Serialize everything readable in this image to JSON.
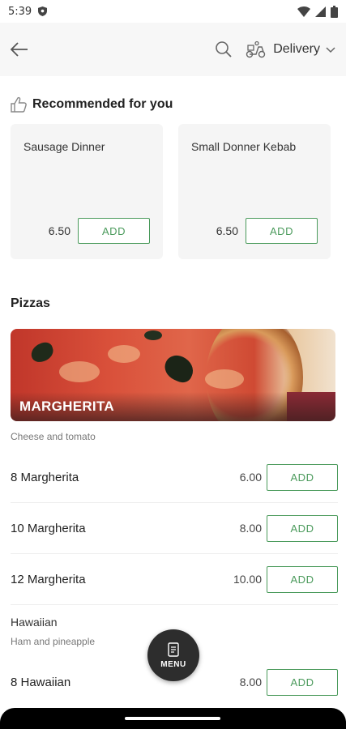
{
  "status_bar": {
    "time": "5:39"
  },
  "app_bar": {
    "delivery_label": "Delivery"
  },
  "recommended": {
    "title": "Recommended for you",
    "items": [
      {
        "name": "Sausage Dinner",
        "price": "6.50",
        "add_label": "ADD"
      },
      {
        "name": "Small Donner Kebab",
        "price": "6.50",
        "add_label": "ADD"
      }
    ]
  },
  "section": {
    "title": "Pizzas",
    "banner": {
      "name": "MARGHERITA",
      "description": "Cheese and tomato"
    },
    "items": [
      {
        "name": "8 Margherita",
        "price": "6.00",
        "add_label": "ADD"
      },
      {
        "name": "10 Margherita",
        "price": "8.00",
        "add_label": "ADD"
      },
      {
        "name": "12 Margherita",
        "price": "10.00",
        "add_label": "ADD"
      }
    ],
    "group": {
      "title": "Hawaiian",
      "description": "Ham and pineapple",
      "items": [
        {
          "name": "8 Hawaiian",
          "price": "8.00",
          "add_label": "ADD"
        }
      ]
    }
  },
  "fab": {
    "label": "MENU"
  },
  "colors": {
    "accent": "#4a9a5b",
    "fab": "#2d2d2d",
    "app_bar_bg": "#f7f7f7",
    "card_bg": "#f5f5f5"
  }
}
